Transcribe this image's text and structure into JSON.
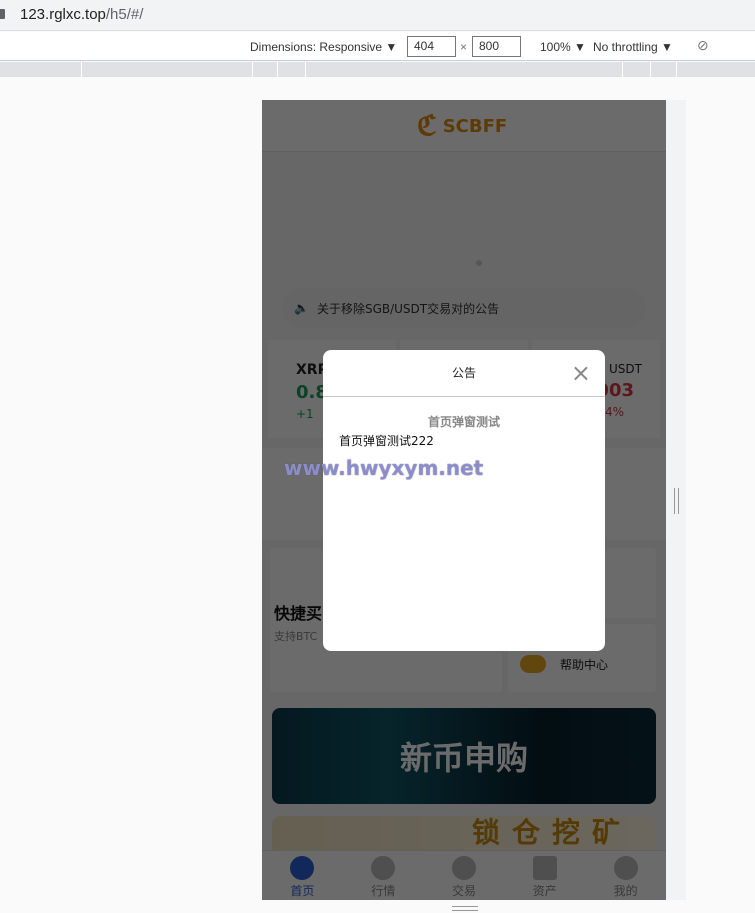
{
  "browser": {
    "url_host": "123.rglxc.top",
    "url_path": "/h5/#/"
  },
  "devtools": {
    "dimensions_label": "Dimensions: Responsive ▼",
    "width": "404",
    "times": "×",
    "height": "800",
    "zoom": "100% ▼",
    "throttling": "No throttling ▼",
    "rotate_icon": "rotate-icon"
  },
  "app": {
    "logo_mark": "SC",
    "logo_text": "SCBFF",
    "brand_color": "#e08b0e",
    "notice": "关于移除SGB/USDT交易对的公告",
    "tickers": [
      {
        "pair": "XRP",
        "price": "0.8",
        "change": "+1",
        "color": "#1a9b5e"
      },
      {
        "pair": "USDT",
        "price": "003",
        "change": "4%",
        "color": "#d9363e"
      }
    ],
    "quick": {
      "title": "快捷买",
      "subtitle": "支持BTC"
    },
    "help": "帮助中心",
    "banner_new": "新币申购",
    "banner_gold": "锁仓挖矿",
    "tabs": [
      {
        "label": "首页",
        "active": true
      },
      {
        "label": "行情"
      },
      {
        "label": "交易"
      },
      {
        "label": "资产"
      },
      {
        "label": "我的"
      }
    ]
  },
  "modal": {
    "title": "公告",
    "close": "×",
    "heading": "首页弹窗测试",
    "body": "首页弹窗测试222"
  },
  "watermark": "www.hwyxym.net"
}
